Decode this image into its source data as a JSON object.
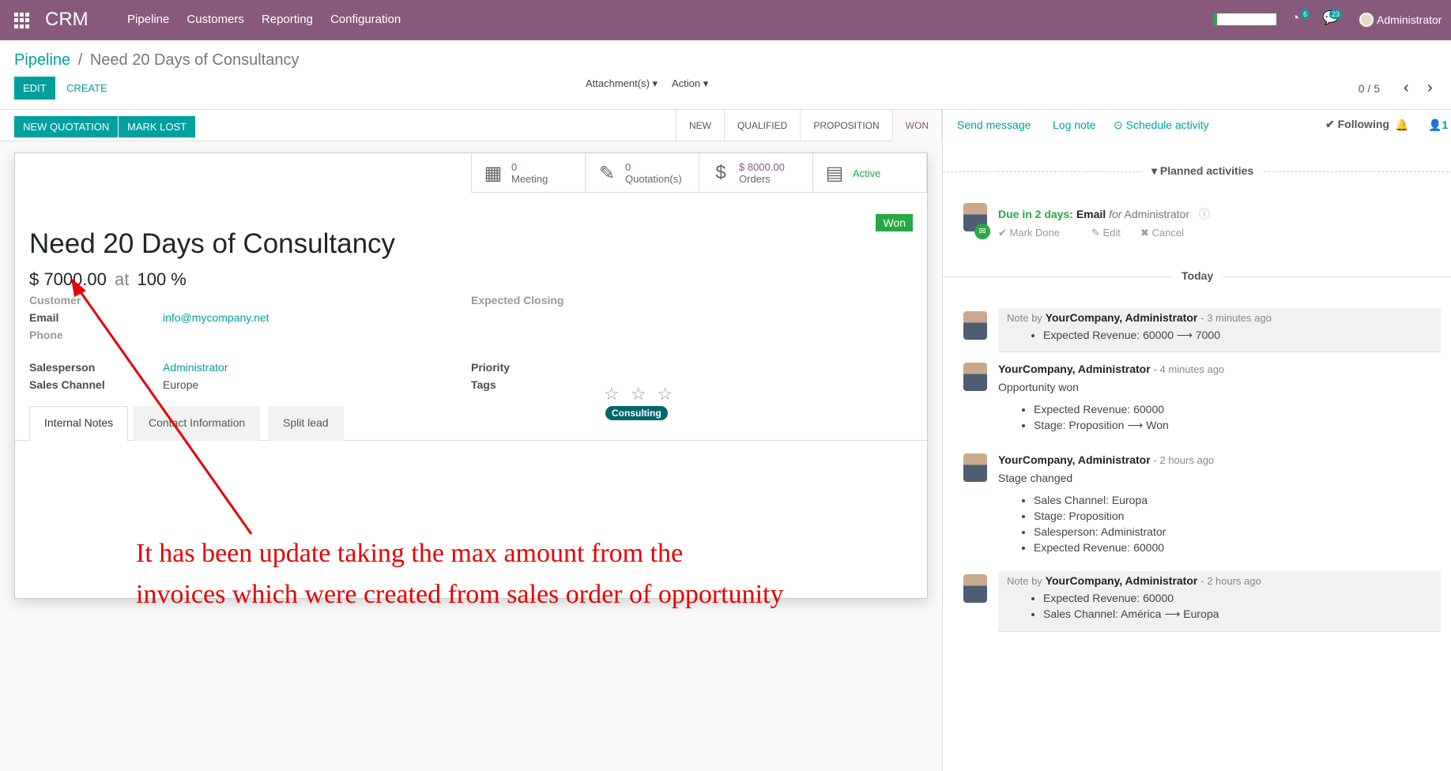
{
  "app": {
    "name": "CRM",
    "menu": [
      "Pipeline",
      "Customers",
      "Reporting",
      "Configuration"
    ],
    "user": "Administrator",
    "activity_badge": "6",
    "message_badge": "23"
  },
  "breadcrumb": {
    "parent": "Pipeline",
    "sep": "/",
    "current": "Need 20 Days of Consultancy"
  },
  "cp": {
    "edit": "EDIT",
    "create": "CREATE",
    "attachments": "Attachment(s) ▾",
    "action": "Action ▾",
    "pager": "0 / 5"
  },
  "statusbar": {
    "new_quotation": "NEW QUOTATION",
    "mark_lost": "MARK LOST",
    "stages": [
      "NEW",
      "QUALIFIED",
      "PROPOSITION",
      "WON"
    ]
  },
  "smart_buttons": [
    {
      "value": "0",
      "label": "Meeting",
      "icon": "calendar-icon"
    },
    {
      "value": "0",
      "label": "Quotation(s)",
      "icon": "edit-icon"
    },
    {
      "value": "$ 8000.00",
      "label": "Orders",
      "icon": "dollar-icon"
    },
    {
      "value": "",
      "label": "Active",
      "icon": "archive-icon"
    }
  ],
  "record": {
    "ribbon": "Won",
    "title": "Need 20 Days of Consultancy",
    "revenue": "$ 7000.00",
    "at": "at",
    "probability": "100 %",
    "customer_label": "Customer",
    "email_label": "Email",
    "email": "info@mycompany.net",
    "phone_label": "Phone",
    "closing_label": "Expected Closing",
    "salesperson_label": "Salesperson",
    "salesperson": "Administrator",
    "channel_label": "Sales Channel",
    "channel": "Europe",
    "priority_label": "Priority",
    "priority": "☆ ☆ ☆",
    "tags_label": "Tags",
    "tag": "Consulting"
  },
  "tabs": [
    "Internal Notes",
    "Contact Information",
    "Split lead"
  ],
  "annotation": {
    "line1": "It has been update taking the max amount from the",
    "line2": "invoices which were created from sales order of opportunity"
  },
  "chatter": {
    "send_message": "Send message",
    "log_note": "Log note",
    "schedule": "⊙ Schedule activity",
    "following": "✔ Following",
    "followers": "1",
    "planned": "▾ Planned activities",
    "activity": {
      "due": "Due in 2 days:",
      "type": "Email",
      "for": "for",
      "user": "Administrator",
      "mark_done": "✔ Mark Done",
      "edit": "✎ Edit",
      "cancel": "✖ Cancel"
    },
    "today": "Today",
    "messages": [
      {
        "prefix": "Note by",
        "author": "YourCompany, Administrator",
        "time": "- 3 minutes ago",
        "body": "",
        "items": [
          "Expected Revenue: 60000 ⟶ 7000"
        ]
      },
      {
        "prefix": "",
        "author": "YourCompany, Administrator",
        "time": "- 4 minutes ago",
        "body": "Opportunity won",
        "items": [
          "Expected Revenue: 60000",
          "Stage: Proposition ⟶ Won"
        ]
      },
      {
        "prefix": "",
        "author": "YourCompany, Administrator",
        "time": "- 2 hours ago",
        "body": "Stage changed",
        "items": [
          "Sales Channel: Europa",
          "Stage: Proposition",
          "Salesperson: Administrator",
          "Expected Revenue: 60000"
        ]
      },
      {
        "prefix": "Note by",
        "author": "YourCompany, Administrator",
        "time": "- 2 hours ago",
        "body": "",
        "items": [
          "Expected Revenue: 60000",
          "Sales Channel: América ⟶ Europa"
        ]
      }
    ]
  }
}
